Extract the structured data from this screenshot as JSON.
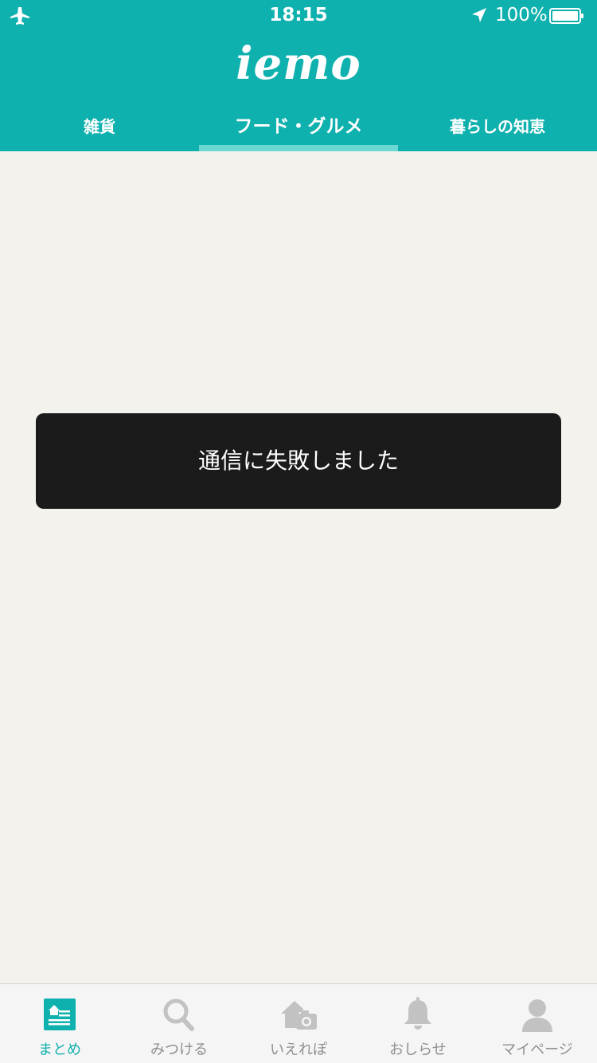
{
  "status_bar": {
    "time": "18:15",
    "battery": "100%",
    "icons": [
      "airplane-icon",
      "location-arrow-icon",
      "battery-icon"
    ]
  },
  "header": {
    "logo": "iemo",
    "tabs": [
      {
        "label": "雑貨",
        "active": false
      },
      {
        "label": "フード・グルメ",
        "active": true
      },
      {
        "label": "暮らしの知恵",
        "active": false
      }
    ]
  },
  "toast": {
    "message": "通信に失敗しました"
  },
  "tabbar": {
    "items": [
      {
        "label": "まとめ",
        "icon": "home-list-icon",
        "active": true
      },
      {
        "label": "みつける",
        "icon": "search-icon",
        "active": false
      },
      {
        "label": "いえれぽ",
        "icon": "house-camera-icon",
        "active": false
      },
      {
        "label": "おしらせ",
        "icon": "bell-icon",
        "active": false
      },
      {
        "label": "マイページ",
        "icon": "user-icon",
        "active": false
      }
    ]
  },
  "colors": {
    "brand": "#0eb1ae",
    "tab_indicator": "#6bd8d3",
    "background": "#f3f2ec",
    "toast_bg": "#1b1b1b",
    "inactive": "#8f8f8f"
  }
}
